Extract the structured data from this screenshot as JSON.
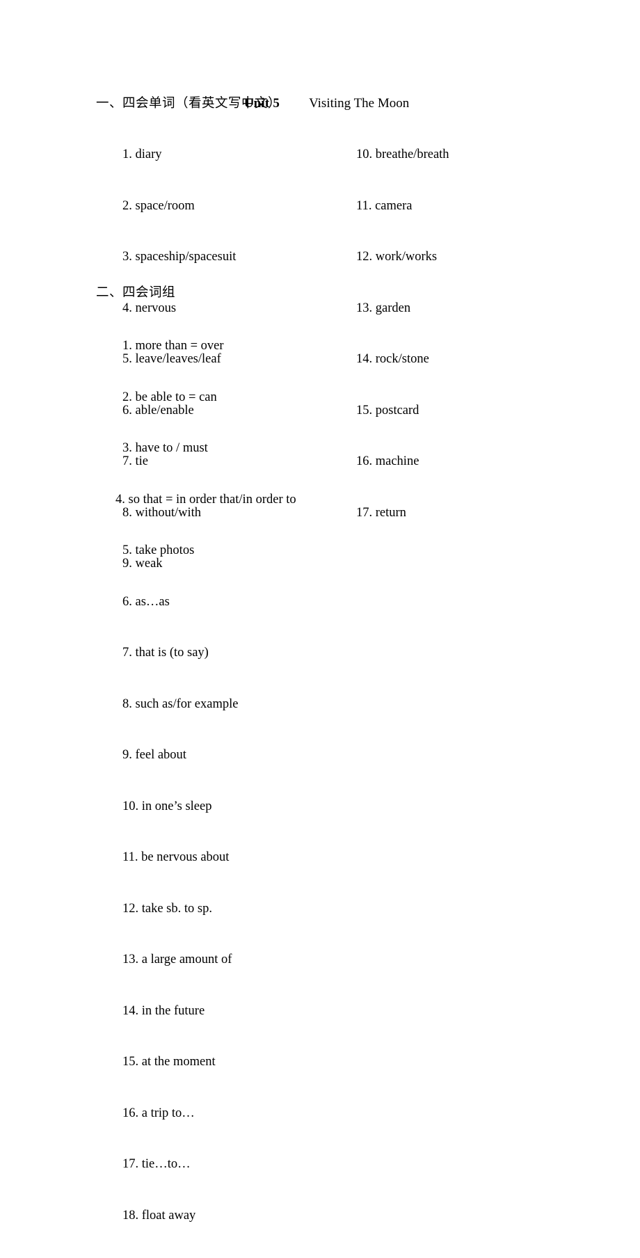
{
  "document": {
    "title_unit": "Unit 5",
    "title_topic": "Visiting The Moon"
  },
  "sections": [
    {
      "heading": "一、四会单词（看英文写中文）",
      "columns": {
        "left": [
          "1. diary",
          "2. space/room",
          "3. spaceship/spacesuit",
          "4. nervous",
          "5. leave/leaves/leaf",
          "6. able/enable",
          "7. tie",
          "8. without/with",
          "9. weak"
        ],
        "right": [
          "10. breathe/breath",
          "11. camera",
          "12. work/works",
          "13. garden",
          "14. rock/stone",
          "15. postcard",
          "16. machine",
          "17. return"
        ]
      }
    },
    {
      "heading": "二、四会词组",
      "items": [
        "1. more than = over",
        "2. be able to = can",
        "3. have to / must",
        "4. so that = in order that/in order to",
        "5. take photos",
        "6. as…as",
        "7. that is (to say)",
        "8. such as/for example",
        "9. feel about",
        "10. in one’s sleep",
        "11. be nervous about",
        "12. take sb. to sp.",
        "13. a large amount of",
        "14. in the future",
        "15. at the moment",
        "16. a trip to…",
        "17. tie…to…",
        "18. float away"
      ]
    }
  ],
  "colors": {
    "page_background": "#ffffff",
    "text": "#000000"
  }
}
